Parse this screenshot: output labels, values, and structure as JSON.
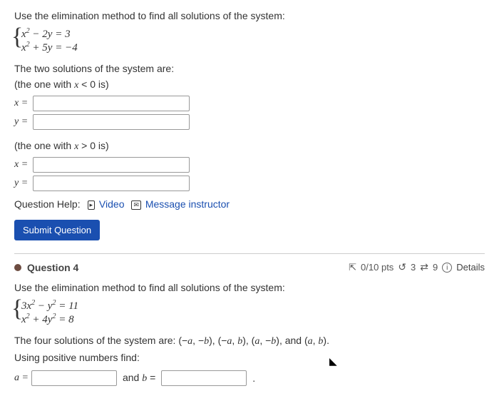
{
  "q3": {
    "prompt": "Use the elimination method to find all solutions of the system:",
    "eq1_html": "x² − 2y = 3",
    "eq2_html": "x² + 5y = −4",
    "two_sol": "The two solutions of the system are:",
    "cond_neg": "(the one with x < 0 is)",
    "cond_pos": "(the one with x > 0 is)",
    "x_label": "x =",
    "y_label": "y =",
    "help_label": "Question Help:",
    "video_label": "Video",
    "msg_label": "Message instructor",
    "submit": "Submit Question"
  },
  "q4": {
    "title": "Question 4",
    "score": "0/10 pts",
    "attempts": "3",
    "tries": "9",
    "details": "Details",
    "prompt": "Use the elimination method to find all solutions of the system:",
    "eq1_html": "3x² − y² = 11",
    "eq2_html": "x² + 4y² = 8",
    "four_sol": "The four solutions of the system are: (−a, −b), (−a, b), (a, −b), and (a, b).",
    "using_pos": "Using positive numbers find:",
    "a_label": "a =",
    "b_label": "and b ="
  }
}
